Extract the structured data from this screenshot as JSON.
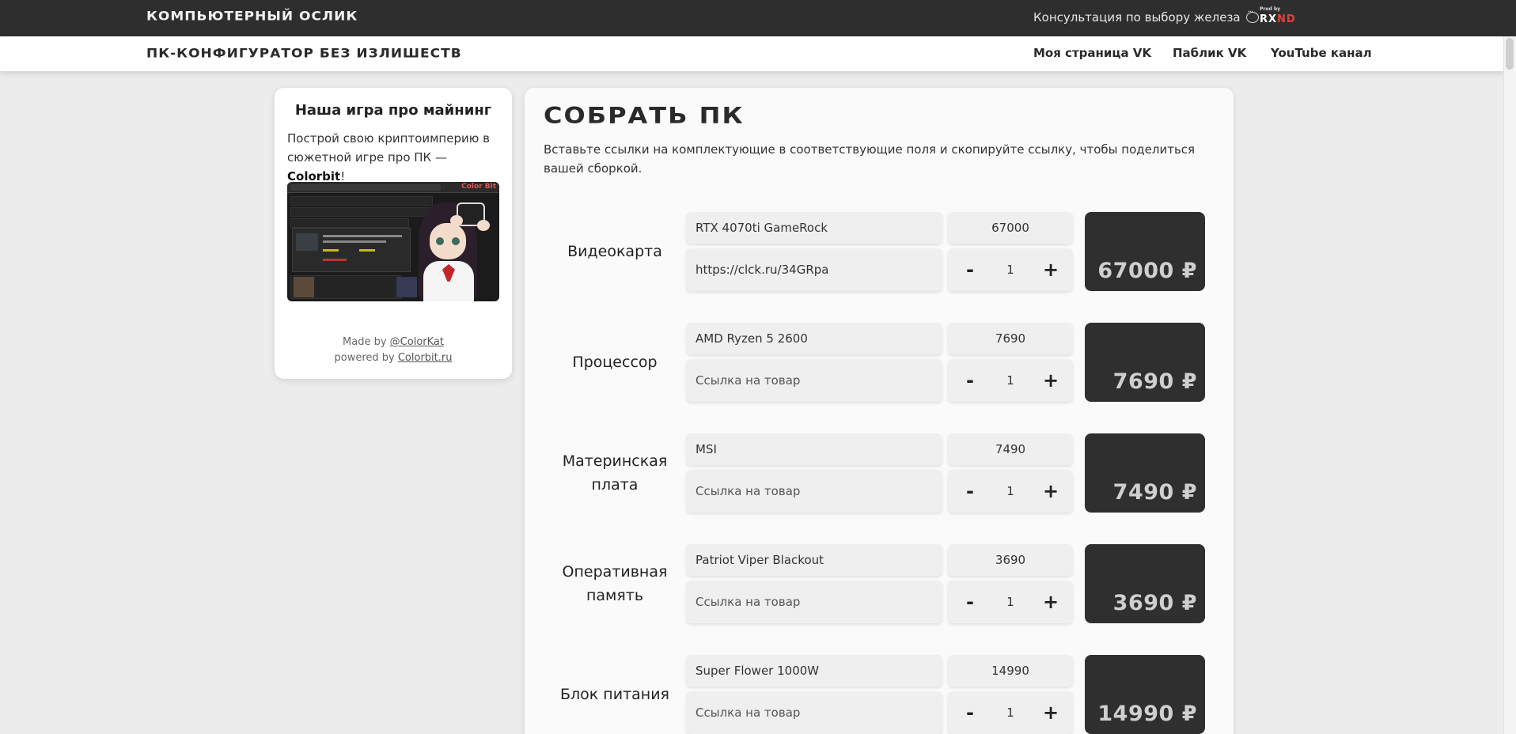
{
  "header": {
    "brand": "КОМПЬЮТЕРНЫЙ ОСЛИК",
    "consult": "Консультация по выбору железа",
    "prod_small": "Prod by",
    "prod_logo_a": "RX",
    "prod_logo_b": "ND"
  },
  "nav": {
    "subtitle": "ПК-КОНФИГУРАТОР БЕЗ ИЗЛИШЕСТВ",
    "links": [
      "Моя страница VK",
      "Паблик VK",
      "YouTube канал"
    ]
  },
  "promo": {
    "title": "Наша игра про майнинг",
    "text_a": "Построй свою криптоимперию в сюжетной игре про ПК — ",
    "text_bold": "Colorbit",
    "text_end": "!",
    "image_label": "Color Bit",
    "made_by_prefix": "Made by ",
    "made_by_link": "@ColorKat",
    "powered_prefix": "powered by ",
    "powered_link": "Colorbit.ru"
  },
  "main": {
    "title": "СОБРАТЬ ПК",
    "description": "Вставьте ссылки на комплектующие в соответствующие поля и скопируйте ссылку, чтобы поделиться вашей сборкой.",
    "minus": "-",
    "plus": "+",
    "rows": [
      {
        "label": "Видеокарта",
        "name": "RTX 4070ti GameRock",
        "link": "https://clck.ru/34GRpa",
        "link_placeholder": "Ссылка на товар",
        "price": "67000",
        "qty": "1",
        "total": "67000 ₽"
      },
      {
        "label": "Процессор",
        "name": "AMD Ryzen 5 2600",
        "link": "",
        "link_placeholder": "Ссылка на товар",
        "price": "7690",
        "qty": "1",
        "total": "7690 ₽"
      },
      {
        "label": "Материнская плата",
        "name": "MSI",
        "link": "",
        "link_placeholder": "Ссылка на товар",
        "price": "7490",
        "qty": "1",
        "total": "7490 ₽"
      },
      {
        "label": "Оперативная память",
        "name": "Patriot Viper Blackout",
        "link": "",
        "link_placeholder": "Ссылка на товар",
        "price": "3690",
        "qty": "1",
        "total": "3690 ₽"
      },
      {
        "label": "Блок питания",
        "name": "Super Flower 1000W",
        "link": "",
        "link_placeholder": "Ссылка на товар",
        "price": "14990",
        "qty": "1",
        "total": "14990 ₽"
      }
    ]
  }
}
